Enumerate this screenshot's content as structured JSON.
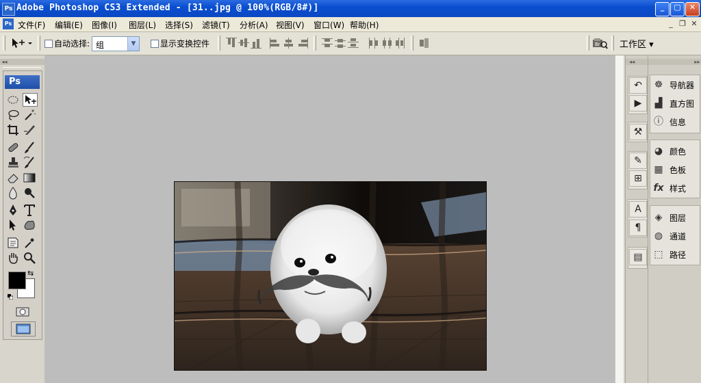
{
  "window": {
    "title": "Adobe Photoshop CS3 Extended - [31..jpg @ 100%(RGB/8#)]",
    "app_icon": "Ps",
    "controls": {
      "minimize": "_",
      "maximize": "▢",
      "close": "✕"
    }
  },
  "menu": {
    "items": [
      "文件(F)",
      "编辑(E)",
      "图像(I)",
      "图层(L)",
      "选择(S)",
      "滤镜(T)",
      "分析(A)",
      "视图(V)",
      "窗口(W)",
      "帮助(H)"
    ],
    "doc_controls": {
      "minimize": "_",
      "restore": "❐",
      "close": "✕"
    }
  },
  "options_bar": {
    "auto_select_label": "自动选择:",
    "auto_select_value": "组",
    "show_transform_label": "显示变换控件",
    "workspace_label": "工作区 ▾"
  },
  "toolbox": {
    "logo": "Ps"
  },
  "panels_dock": [
    {
      "group": [
        {
          "icon": "navigator-icon",
          "label": "导航器"
        },
        {
          "icon": "histogram-icon",
          "label": "直方图"
        },
        {
          "icon": "info-icon",
          "label": "信息"
        }
      ]
    },
    {
      "group": [
        {
          "icon": "color-icon",
          "label": "颜色"
        },
        {
          "icon": "swatches-icon",
          "label": "色板"
        },
        {
          "icon": "styles-icon",
          "label": "样式"
        }
      ]
    },
    {
      "group": [
        {
          "icon": "layers-icon",
          "label": "图层"
        },
        {
          "icon": "channels-icon",
          "label": "通道"
        },
        {
          "icon": "paths-icon",
          "label": "路径"
        }
      ]
    }
  ],
  "colors": {
    "titlebar": "#0a4fd0",
    "workspace": "#bdbdbd",
    "foreground": "#000000",
    "background": "#ffffff"
  }
}
